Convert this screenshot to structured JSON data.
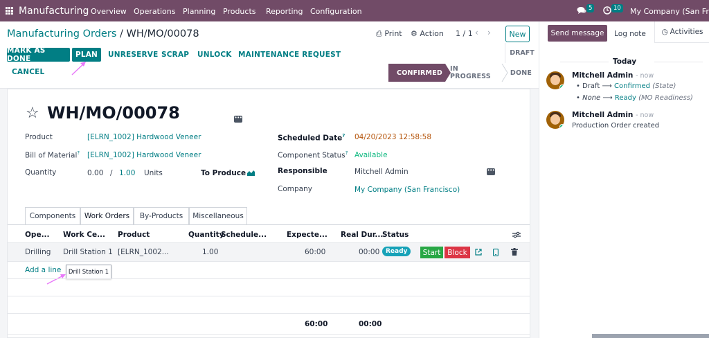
{
  "navbar": {
    "app_name": "Manufacturing",
    "menus": [
      "Overview",
      "Operations",
      "Planning",
      "Products",
      "Reporting",
      "Configuration"
    ],
    "messages_count": "5",
    "activities_count": "10",
    "company": "My Company (San Franc"
  },
  "control": {
    "breadcrumb_parent": "Manufacturing Orders",
    "breadcrumb_separator": "/",
    "breadcrumb_current": "WH/MO/00078",
    "print_label": "Print",
    "action_label": "Action",
    "pager": "1 / 1",
    "new_label": "New",
    "buttons": {
      "mark_as_done": "MARK AS DONE",
      "plan": "PLAN",
      "unreserve": "UNRESERVE",
      "scrap": "SCRAP",
      "unlock": "UNLOCK",
      "maintenance": "MAINTENANCE REQUEST",
      "cancel": "CANCEL"
    },
    "statusbar": {
      "draft": "DRAFT",
      "confirmed": "CONFIRMED",
      "in_progress": "IN PROGRESS",
      "done": "DONE"
    }
  },
  "chatter": {
    "send_message": "Send message",
    "log_note": "Log note",
    "activities": "Activities",
    "today": "Today",
    "messages": [
      {
        "author": "Mitchell Admin",
        "when": "- now",
        "tracking": [
          {
            "old": "Draft",
            "arrow": "⟶",
            "new": "Confirmed",
            "field": "(State)"
          },
          {
            "old": "None",
            "arrow": "⟶",
            "new": "Ready",
            "field": "(MO Readiness)"
          }
        ]
      },
      {
        "author": "Mitchell Admin",
        "when": "- now",
        "body": "Production Order created"
      }
    ]
  },
  "form": {
    "name": "WH/MO/00078",
    "fields": {
      "product_label": "Product",
      "product_value": "[ELRN_1002] Hardwood Veneer",
      "bom_label": "Bill of Material",
      "bom_value": "[ELRN_1002] Hardwood Veneer",
      "qty_label": "Quantity",
      "qty_done": "0.00",
      "qty_sep": "/",
      "qty_total": "1.00",
      "qty_uom": "Units",
      "to_produce": "To Produce",
      "sched_label": "Scheduled Date",
      "sched_value": "04/20/2023 12:58:58",
      "comp_status_label": "Component Status",
      "comp_status_value": "Available",
      "responsible_label": "Responsible",
      "responsible_value": "Mitchell Admin",
      "company_label": "Company",
      "company_value": "My Company (San Francisco)"
    },
    "tabs": [
      "Components",
      "Work Orders",
      "By-Products",
      "Miscellaneous"
    ],
    "table": {
      "headers": [
        "Ope...",
        "Work Ce...",
        "Product",
        "Quantity",
        "Schedule...",
        "Expecte...",
        "Real Dur...",
        "Status"
      ],
      "row": {
        "operation": "Drilling",
        "workcenter": "Drill Station 1",
        "product": "[ELRN_1002...",
        "quantity": "1.00",
        "expected": "60:00",
        "real": "00:00",
        "status": "Ready",
        "start": "Start",
        "block": "Block"
      },
      "add_line": "Add a line",
      "tooltip": "Drill Station 1",
      "total_expected": "60:00",
      "total_real": "00:00"
    }
  }
}
